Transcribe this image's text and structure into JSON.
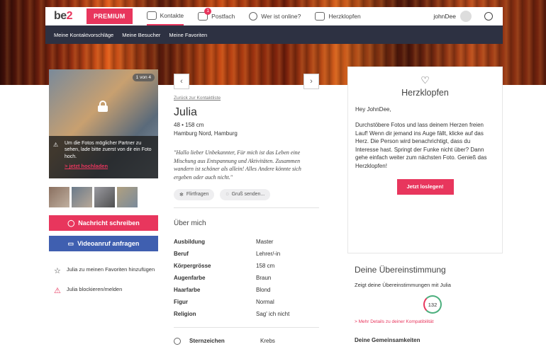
{
  "header": {
    "logo_a": "be",
    "logo_b": "2",
    "premium": "PREMIUM",
    "nav": [
      {
        "label": "Kontakte"
      },
      {
        "label": "Postfach",
        "badge": "1"
      },
      {
        "label": "Wer ist online?"
      },
      {
        "label": "Herzklopfen"
      }
    ],
    "username": "johnDee"
  },
  "subnav": [
    "Meine Kontaktvorschläge",
    "Meine Besucher",
    "Meine Favoriten"
  ],
  "photo": {
    "counter": "1 von 4",
    "info_text": "Um die Fotos möglicher Partner zu sehen, lade bitte zuerst von dir ein Foto hoch.",
    "upload_link": "> jetzt hochladen"
  },
  "actions": {
    "message": "Nachricht schreiben",
    "video": "Videoanruf anfragen",
    "favorite": "Julia zu meinen Favoriten hinzufügen",
    "block": "Julia blockieren/melden"
  },
  "profile": {
    "back": "Zurück zur Kontaktliste",
    "name": "Julia",
    "age_height": "48 • 158 cm",
    "location": "Hamburg Nord, Hamburg",
    "quote": "\"Hallo lieber Unbekannter, Für mich ist das Leben eine Mischung aus Entspannung und Aktivitäten. Zusammen wandern ist schöner als allein! Alles Andere könnte sich ergeben oder auch nicht.\"",
    "chip_flirt": "Flirtfragen",
    "chip_greet": "Gruß senden...",
    "about_title": "Über mich",
    "attributes": [
      {
        "k": "Ausbildung",
        "v": "Master"
      },
      {
        "k": "Beruf",
        "v": "Lehrer/-in"
      },
      {
        "k": "Körpergrösse",
        "v": "158 cm"
      },
      {
        "k": "Augenfarbe",
        "v": "Braun"
      },
      {
        "k": "Haarfarbe",
        "v": "Blond"
      },
      {
        "k": "Figur",
        "v": "Normal"
      },
      {
        "k": "Religion",
        "v": "Sag' ich nicht"
      }
    ],
    "zodiac_k": "Sternzeichen",
    "zodiac_v": "Krebs"
  },
  "herzklopfen": {
    "title": "Herzklopfen",
    "greeting": "Hey JohnDee,",
    "text": "Durchstöbere Fotos und lass deinem Herzen freien Lauf! Wenn dir jemand ins Auge fällt, klicke auf das Herz. Die Person wird benachrichtigt, dass du Interesse hast. Springt der Funke nicht über? Dann gehe einfach weiter zum nächsten Foto. Genieß das Herzklopfen!",
    "button": "Jetzt loslegen!"
  },
  "match": {
    "title": "Deine Übereinstimmung",
    "subtitle": "Zeigt deine Übereinstimmungen mit Julia",
    "score": "132",
    "more": "> Mehr Details zu deiner Kompatibilität",
    "common": "Deine Gemeinsamkeiten"
  },
  "colors": {
    "accent": "#e8365d",
    "video": "#3f5fb0",
    "subnav": "#2d3142"
  }
}
